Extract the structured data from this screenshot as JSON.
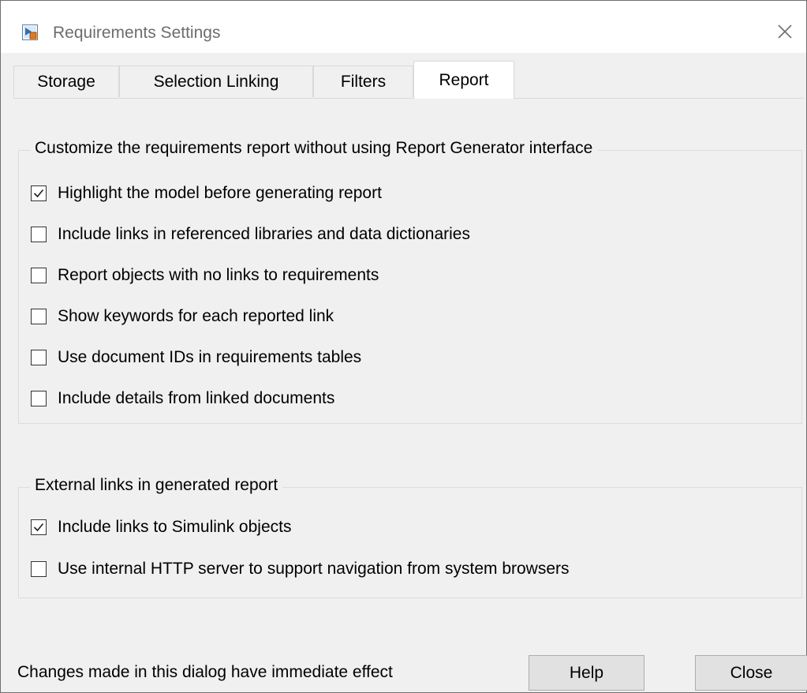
{
  "window": {
    "title": "Requirements Settings",
    "close_icon": "close-icon",
    "app_icon": "simulink-requirements-icon"
  },
  "tabs": [
    {
      "label": "Storage",
      "active": false
    },
    {
      "label": "Selection Linking",
      "active": false
    },
    {
      "label": "Filters",
      "active": false
    },
    {
      "label": "Report",
      "active": true
    }
  ],
  "report_group": {
    "legend": "Customize the requirements report without using Report Generator interface",
    "options": [
      {
        "label": "Highlight the model before generating report",
        "checked": true
      },
      {
        "label": "Include links in referenced libraries and data dictionaries",
        "checked": false
      },
      {
        "label": "Report objects with no links to requirements",
        "checked": false
      },
      {
        "label": "Show keywords for each reported link",
        "checked": false
      },
      {
        "label": "Use document IDs in requirements tables",
        "checked": false
      },
      {
        "label": "Include details from linked documents",
        "checked": false
      }
    ]
  },
  "external_group": {
    "legend": "External links in generated report",
    "options": [
      {
        "label": "Include links to Simulink objects",
        "checked": true
      },
      {
        "label": "Use internal HTTP server to support navigation from system browsers",
        "checked": false
      }
    ]
  },
  "footer": {
    "status_text": "Changes made in this dialog have immediate effect",
    "help_label": "Help",
    "close_label": "Close"
  }
}
